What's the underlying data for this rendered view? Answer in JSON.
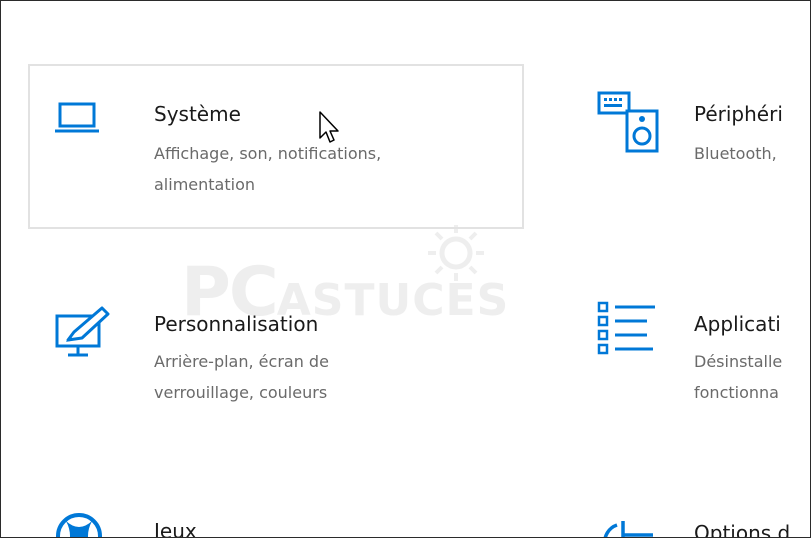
{
  "tiles": [
    {
      "title": "Système",
      "desc_line1": "Affichage, son, notifications,",
      "desc_line2": "alimentation",
      "icon": "laptop-icon"
    },
    {
      "title": "Périphéri",
      "desc_line1": "Bluetooth,",
      "desc_line2": "",
      "icon": "devices-icon"
    },
    {
      "title": "Personnalisation",
      "desc_line1": "Arrière-plan, écran de",
      "desc_line2": "verrouillage, couleurs",
      "icon": "personalization-icon"
    },
    {
      "title": "Applicati",
      "desc_line1": "Désinstalle",
      "desc_line2": "fonctionna",
      "icon": "apps-list-icon"
    },
    {
      "title": "Jeux",
      "desc_line1": "",
      "desc_line2": "",
      "icon": "xbox-icon"
    },
    {
      "title": "Options d",
      "desc_line1": "",
      "desc_line2": "",
      "icon": "ease-of-access-icon"
    }
  ],
  "watermark": {
    "big": "PC",
    "small": "ASTUCES"
  },
  "colors": {
    "accent": "#0078d7",
    "watermark": "#eeeeee"
  }
}
